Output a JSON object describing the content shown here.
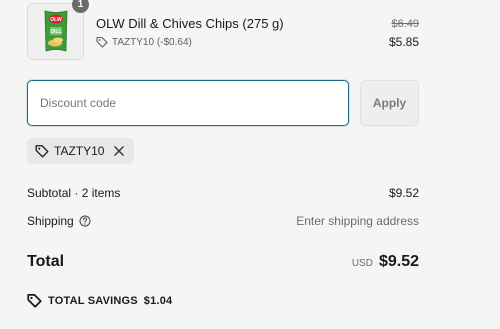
{
  "product": {
    "title": "OLW Dill & Chives Chips (275 g)",
    "quantity": "1",
    "discount_label": "TAZTY10 (-$0.64)",
    "price_original": "$6.49",
    "price_final": "$5.85",
    "image_brand_text": "OLW",
    "image_flavor_text": "DILL"
  },
  "discount": {
    "placeholder": "Discount code",
    "apply_label": "Apply",
    "applied_code": "TAZTY10"
  },
  "summary": {
    "subtotal_label": "Subtotal · 2 items",
    "subtotal_value": "$9.52",
    "shipping_label": "Shipping",
    "shipping_value": "Enter shipping address",
    "total_label": "Total",
    "total_currency": "USD",
    "total_value": "$9.52",
    "savings_label": "TOTAL SAVINGS",
    "savings_value": "$1.04"
  },
  "icons": {
    "tag": "tag-icon",
    "close": "close-icon",
    "help": "question-circle-icon"
  },
  "colors": {
    "input_focus_border": "#1f6b8d",
    "background": "#f5f5f5",
    "bag_green": "#3e9b3a"
  }
}
